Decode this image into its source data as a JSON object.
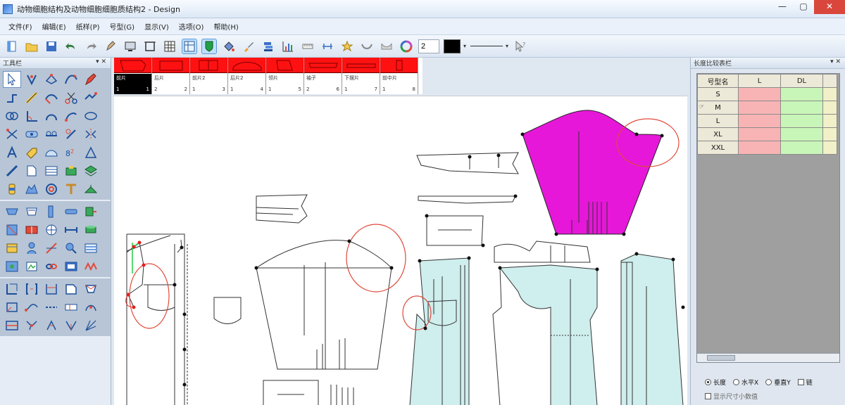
{
  "window": {
    "title": "动物细胞结构及动物细胞细胞质结构2 - Design",
    "controls": [
      "—",
      "▢",
      "✕"
    ]
  },
  "menu": [
    "文件(F)",
    "编辑(E)",
    "纸样(P)",
    "号型(G)",
    "显示(V)",
    "选项(O)",
    "帮助(H)"
  ],
  "toolbar": {
    "thickness_value": "2",
    "color": "#000000"
  },
  "left_panel": {
    "title": "工具栏",
    "pin": "▾ ✕"
  },
  "pieces": [
    {
      "name": "前片",
      "qty": "1",
      "index": "1",
      "selected": true
    },
    {
      "name": "后片",
      "qty": "2",
      "index": "2"
    },
    {
      "name": "前片2",
      "qty": "1",
      "index": "3"
    },
    {
      "name": "后片2",
      "qty": "1",
      "index": "4"
    },
    {
      "name": "领片",
      "qty": "1",
      "index": "5"
    },
    {
      "name": "袖子",
      "qty": "2",
      "index": "6"
    },
    {
      "name": "下摆片",
      "qty": "1",
      "index": "7"
    },
    {
      "name": "前中片",
      "qty": "1",
      "index": "8"
    }
  ],
  "right_panel": {
    "title": "长度比较表栏",
    "pin": "▾ ✕",
    "columns": [
      "号型名",
      "L",
      "DL"
    ],
    "sizes": [
      "S",
      "M",
      "L",
      "XL",
      "XXL"
    ],
    "current_size": "M",
    "options": [
      "长度",
      "水平X",
      "垂直Y",
      "链"
    ],
    "checkbox_label": "显示尺寸小数值"
  }
}
